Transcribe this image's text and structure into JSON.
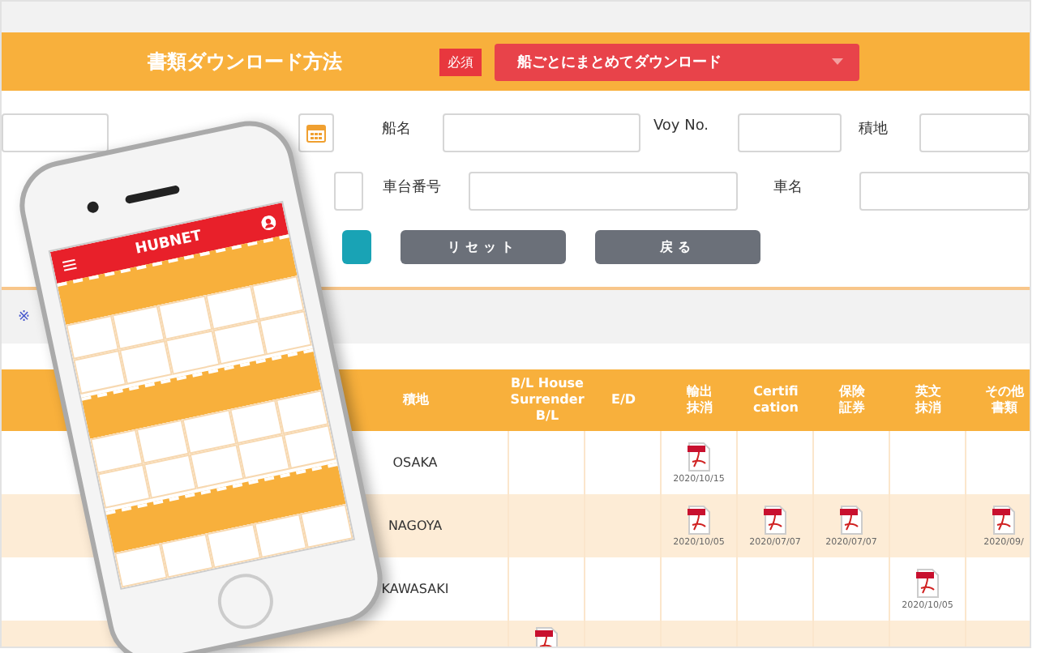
{
  "download_method": {
    "label": "書類ダウンロード方法",
    "required_badge": "必須",
    "select_value": "船ごとにまとめてダウンロード"
  },
  "form_rows": [
    [
      {
        "kind": "field"
      },
      {
        "kind": "date"
      },
      {
        "kind": "field",
        "label": "船名"
      },
      {
        "kind": "field",
        "label": "Voy No."
      },
      {
        "kind": "field",
        "label": "積地"
      }
    ],
    [
      {
        "kind": "field"
      },
      {
        "kind": "field",
        "label": "車台番号"
      },
      {
        "kind": "field",
        "label": "車名"
      }
    ]
  ],
  "buttons": [
    {
      "kind": "primary"
    },
    {
      "kind": "secondary",
      "label": "リセット"
    },
    {
      "kind": "secondary",
      "label": "戻る"
    }
  ],
  "note": "※",
  "table": {
    "columns": [
      "積地",
      "B/L House\nSurrender\nB/L",
      "E/D",
      "輸出抹消",
      "Certifi\ncation",
      "保険証券",
      "英文抹消",
      "その他書類"
    ],
    "rows": [
      {
        "cells": [
          {
            "kind": "text",
            "text": "OSAKA"
          },
          {
            "kind": "empty"
          },
          {
            "kind": "empty"
          },
          {
            "kind": "pdf",
            "date": "2020/10/15"
          },
          {
            "kind": "empty"
          },
          {
            "kind": "empty"
          },
          {
            "kind": "empty"
          },
          {
            "kind": "empty"
          }
        ]
      },
      {
        "cells": [
          {
            "kind": "text",
            "text": "NAGOYA"
          },
          {
            "kind": "empty"
          },
          {
            "kind": "empty"
          },
          {
            "kind": "pdf",
            "date": "2020/10/05"
          },
          {
            "kind": "pdf",
            "date": "2020/07/07"
          },
          {
            "kind": "pdf",
            "date": "2020/07/07"
          },
          {
            "kind": "empty"
          },
          {
            "kind": "pdf",
            "date": "2020/09/"
          }
        ]
      },
      {
        "cells": [
          {
            "kind": "text",
            "text": "KAWASAKI"
          },
          {
            "kind": "empty"
          },
          {
            "kind": "empty"
          },
          {
            "kind": "empty"
          },
          {
            "kind": "empty"
          },
          {
            "kind": "empty"
          },
          {
            "kind": "pdf",
            "date": "2020/10/05"
          },
          {
            "kind": "empty"
          }
        ]
      },
      {
        "cells": [
          {
            "kind": "empty"
          },
          {
            "kind": "pdf"
          },
          {
            "kind": "empty"
          },
          {
            "kind": "empty"
          },
          {
            "kind": "empty"
          },
          {
            "kind": "empty"
          },
          {
            "kind": "empty"
          },
          {
            "kind": "empty"
          }
        ]
      }
    ]
  },
  "phone": {
    "logo": "HUBNET"
  }
}
